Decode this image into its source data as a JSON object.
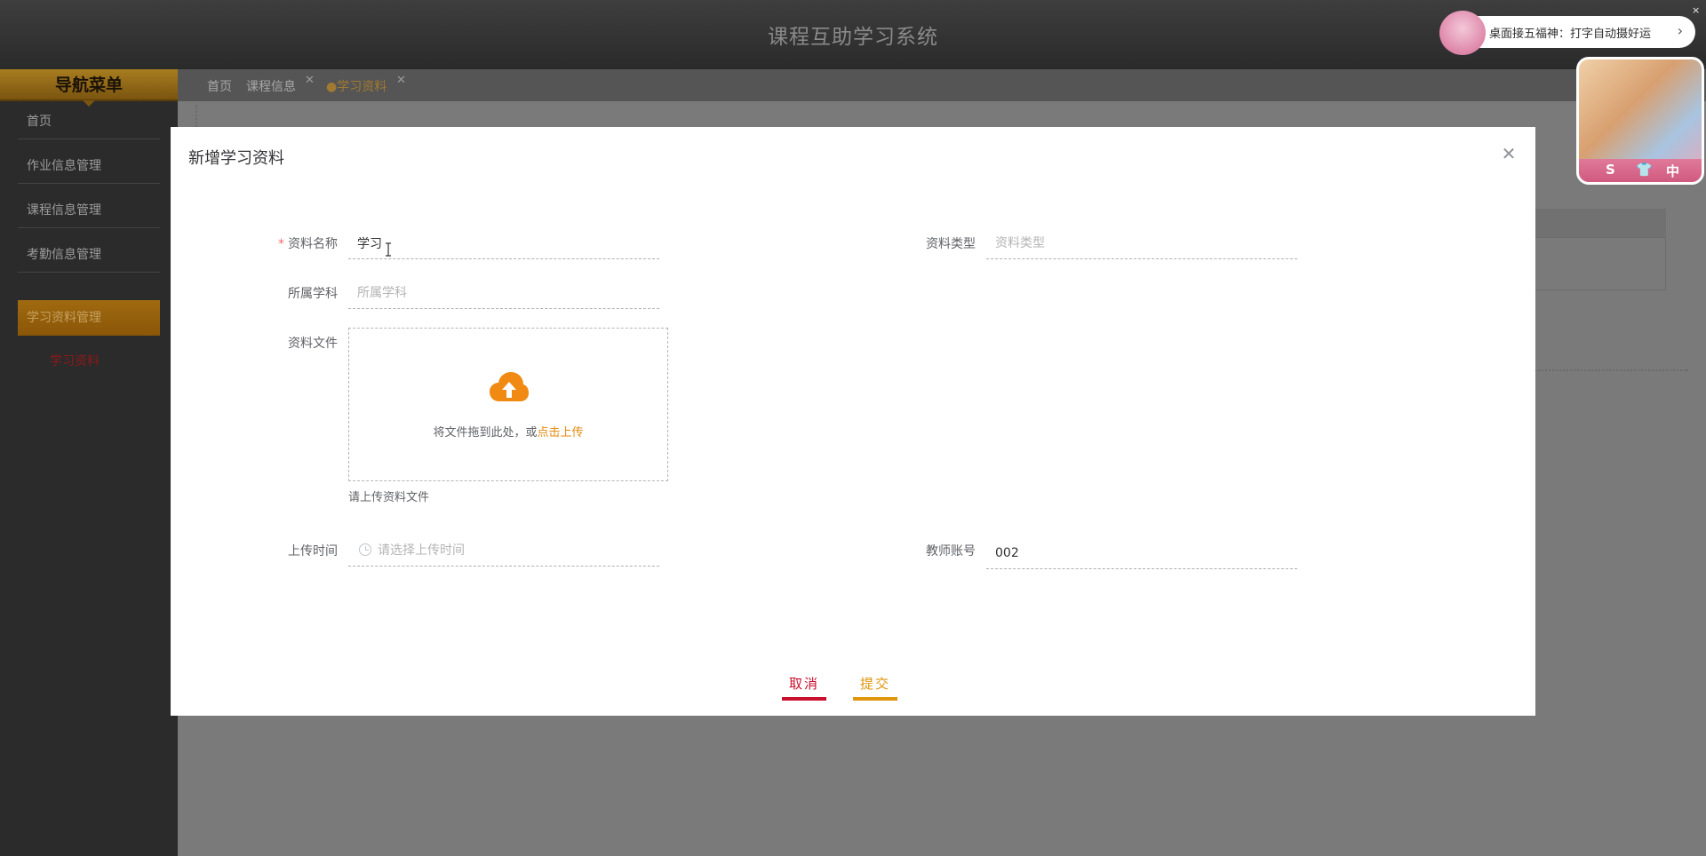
{
  "app": {
    "title": "课程互助学习系统"
  },
  "sidebar": {
    "header": "导航菜单",
    "items": [
      {
        "label": "首页"
      },
      {
        "label": "作业信息管理"
      },
      {
        "label": "课程信息管理"
      },
      {
        "label": "考勤信息管理"
      },
      {
        "label": "学习资料管理",
        "active": true
      }
    ],
    "sub_item": "学习资料"
  },
  "tabs": [
    {
      "label": "首页"
    },
    {
      "label": "课程信息",
      "closable": true
    },
    {
      "label": "●学习资料",
      "closable": true,
      "active": true
    }
  ],
  "tab_close_glyph": "✕",
  "modal": {
    "title": "新增学习资料",
    "close_glyph": "✕",
    "fields": {
      "name": {
        "label": "资料名称",
        "required_mark": "*",
        "value": "学习"
      },
      "type": {
        "label": "资料类型",
        "placeholder": "资料类型"
      },
      "subject": {
        "label": "所属学科",
        "placeholder": "所属学科"
      },
      "file": {
        "label": "资料文件",
        "drop_text": "将文件拖到此处，或",
        "link_text": "点击上传",
        "tip": "请上传资料文件"
      },
      "upload_time": {
        "label": "上传时间",
        "placeholder": "请选择上传时间"
      },
      "teacher_account": {
        "label": "教师账号",
        "value": "002"
      }
    },
    "buttons": {
      "cancel": "取消",
      "submit": "提交"
    }
  },
  "overlay": {
    "banner_text": "桌面接五福神：打字自动摄好运",
    "banner_arrow": "›",
    "close_glyph": "×",
    "photo_bar_glyphs": [
      "S",
      "👕",
      "中"
    ]
  },
  "colors": {
    "accent_red": "#c8102e",
    "accent_orange": "#e0950f",
    "upload_link": "#e38a0f",
    "nav_active": "#a06a10"
  }
}
